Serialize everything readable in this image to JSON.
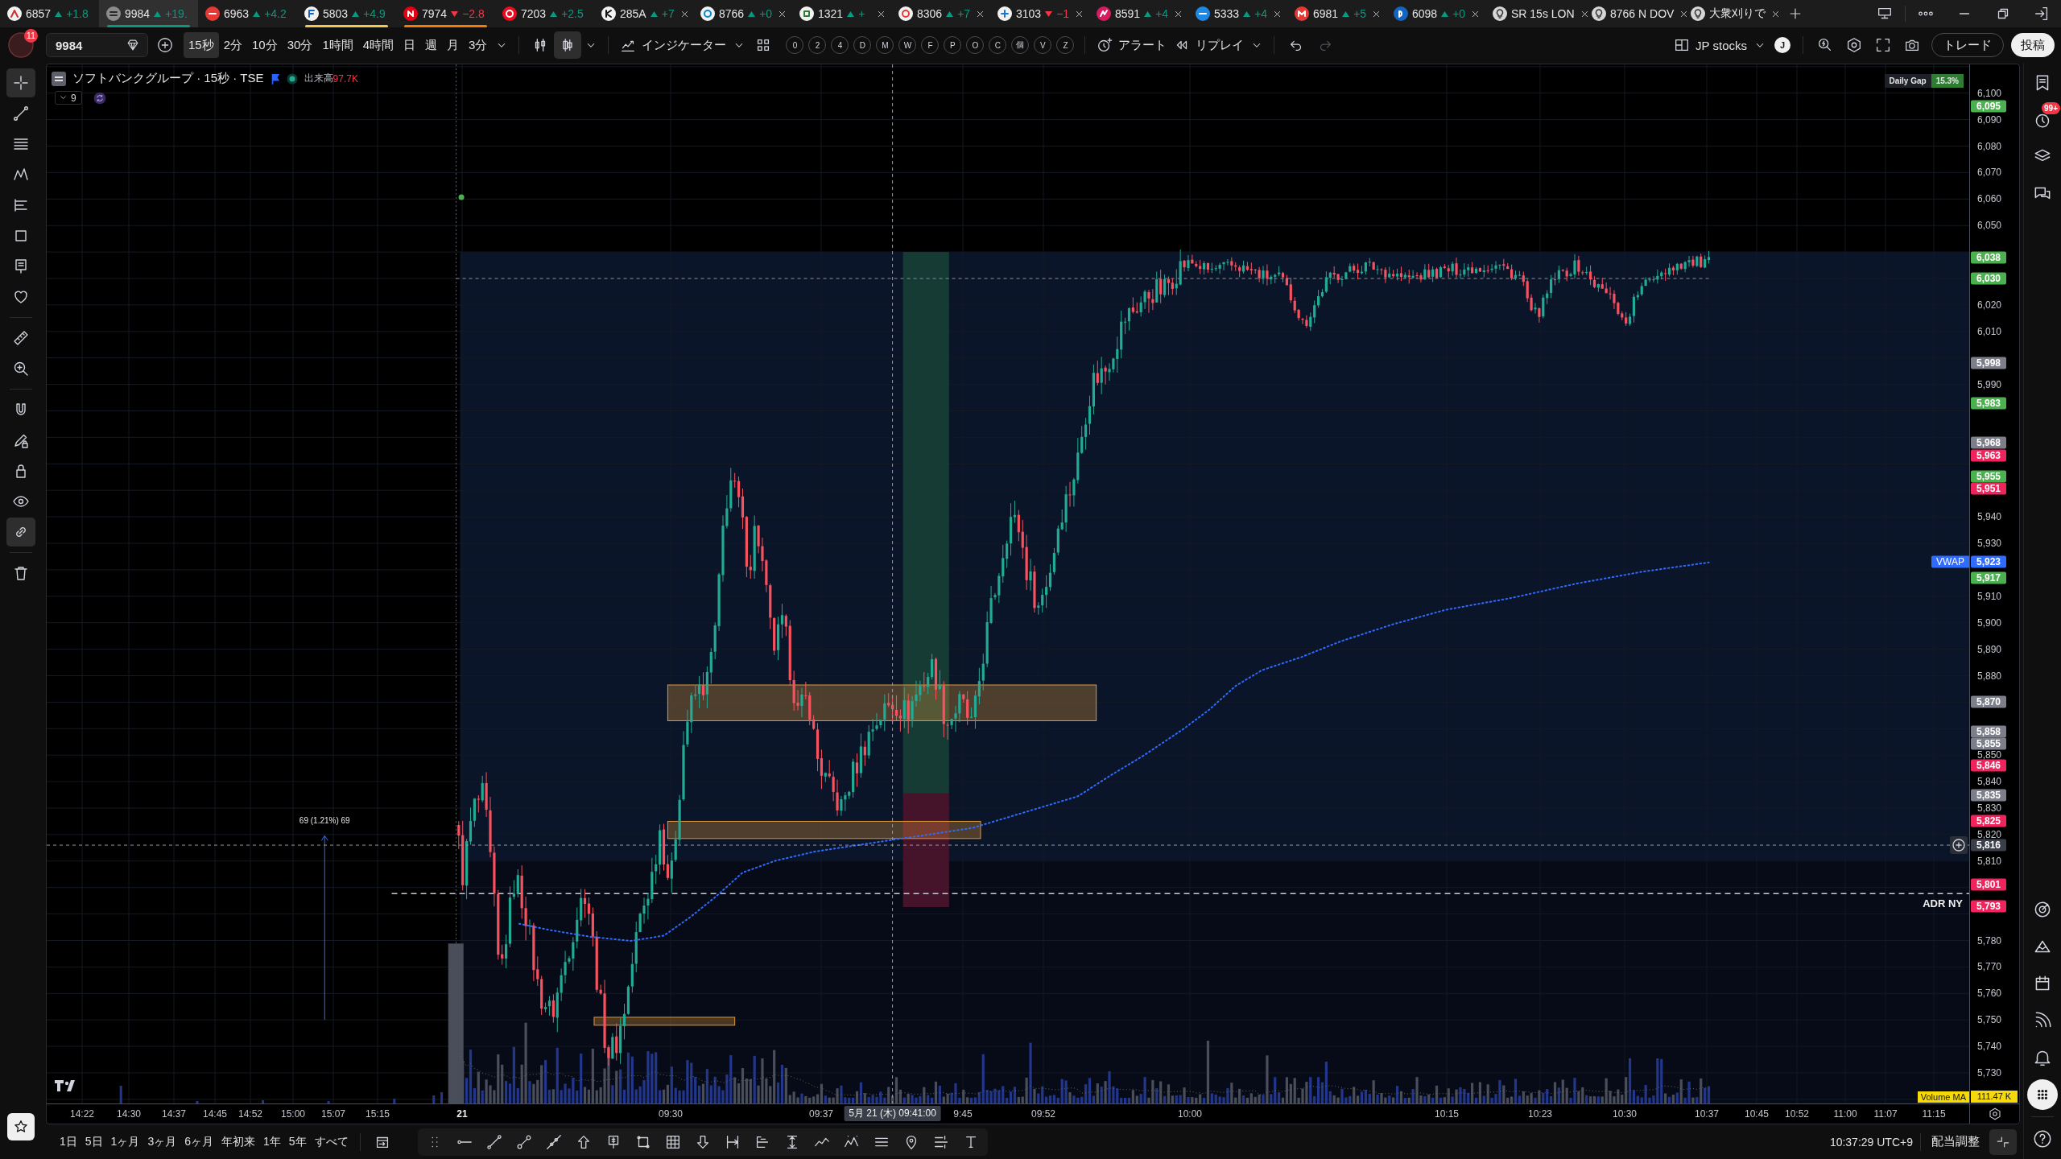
{
  "tabs": [
    {
      "kind": "symbol",
      "symbol": "6857",
      "up": true,
      "change": "+1.8",
      "closable": false,
      "selected": false
    },
    {
      "kind": "symbol",
      "symbol": "9984",
      "up": true,
      "change": "+19.",
      "closable": false,
      "selected": true,
      "color": "#089981"
    },
    {
      "kind": "symbol",
      "symbol": "6963",
      "up": true,
      "change": "+4.2",
      "closable": false,
      "selected": false
    },
    {
      "kind": "symbol",
      "symbol": "5803",
      "up": true,
      "change": "+4.9",
      "closable": false,
      "selected": false,
      "color": "#f2c94c"
    },
    {
      "kind": "symbol",
      "symbol": "7974",
      "up": false,
      "change": "−2.8",
      "closable": false,
      "selected": false,
      "color": "#f57c00"
    },
    {
      "kind": "symbol",
      "symbol": "7203",
      "up": true,
      "change": "+2.5",
      "closable": false,
      "selected": false
    },
    {
      "kind": "symbol",
      "symbol": "285A",
      "up": true,
      "change": "+7",
      "closable": true,
      "selected": false
    },
    {
      "kind": "symbol",
      "symbol": "8766",
      "up": true,
      "change": "+0",
      "closable": true,
      "selected": false
    },
    {
      "kind": "symbol",
      "symbol": "1321",
      "up": true,
      "change": "+",
      "closable": true,
      "selected": false
    },
    {
      "kind": "symbol",
      "symbol": "8306",
      "up": true,
      "change": "+7",
      "closable": true,
      "selected": false
    },
    {
      "kind": "symbol",
      "symbol": "3103",
      "up": false,
      "change": "−1",
      "closable": true,
      "selected": false
    },
    {
      "kind": "symbol",
      "symbol": "8591",
      "up": true,
      "change": "+4",
      "closable": true,
      "selected": false
    },
    {
      "kind": "symbol",
      "symbol": "5333",
      "up": true,
      "change": "+4",
      "closable": true,
      "selected": false
    },
    {
      "kind": "symbol",
      "symbol": "6981",
      "up": true,
      "change": "+5",
      "closable": true,
      "selected": false
    },
    {
      "kind": "symbol",
      "symbol": "6098",
      "up": true,
      "change": "+0",
      "closable": true,
      "selected": false
    },
    {
      "kind": "layout",
      "symbol": "SR 15s LON",
      "closable": true,
      "selected": false
    },
    {
      "kind": "layout",
      "symbol": "8766 N DOV",
      "closable": true,
      "selected": false
    },
    {
      "kind": "layout",
      "symbol": "大衆刈りで",
      "closable": true,
      "selected": false
    }
  ],
  "toolbar": {
    "notifications": "11",
    "symbol": "9984",
    "intervals": [
      {
        "label": "15秒",
        "selected": true
      },
      {
        "label": "2分",
        "selected": false
      },
      {
        "label": "10分",
        "selected": false
      },
      {
        "label": "30分",
        "selected": false
      },
      {
        "label": "1時間",
        "selected": false
      },
      {
        "label": "4時間",
        "selected": false
      },
      {
        "label": "日",
        "selected": false
      },
      {
        "label": "週",
        "selected": false
      },
      {
        "label": "月",
        "selected": false
      },
      {
        "label": "3分",
        "selected": false
      }
    ],
    "chart_styles": [
      {
        "selected": false
      },
      {
        "selected": true
      }
    ],
    "indicators": "インジケーター",
    "shortcuts": [
      "0",
      "2",
      "4",
      "D",
      "M",
      "W",
      "F",
      "P",
      "O",
      "C",
      "個",
      "V",
      "Z"
    ],
    "alert": "アラート",
    "replay": "リプレイ",
    "undo_disabled": false,
    "redo_disabled": true,
    "layout": "JP stocks",
    "user": "J",
    "trade": "トレード",
    "publish": "投稿"
  },
  "left_tools": [
    {
      "selected": true
    },
    {
      "selected": false
    },
    {
      "selected": false
    },
    {
      "selected": false
    },
    {
      "selected": false
    },
    {
      "selected": false
    },
    {
      "selected": false
    },
    {
      "selected": false
    },
    {
      "selected": false
    },
    {
      "selected": false
    },
    {
      "selected": false
    },
    {
      "selected": false
    },
    {
      "selected": false
    },
    {
      "selected": false
    },
    {
      "selected": true
    },
    {
      "selected": false
    }
  ],
  "favorites": {
    "selected": true
  },
  "chart": {
    "title": "ソフトバンクグループ · 15秒 · TSE",
    "volume_label": "出来高",
    "volume_value": "97.7K",
    "indicators_count": "9",
    "daily_gap": {
      "label": "Daily Gap",
      "value": "15.3%"
    },
    "price_ticks": [
      "6,100",
      "6,090",
      "6,080",
      "6,070",
      "6,060",
      "6,050",
      "6,020",
      "6,010",
      "5,990",
      "5,940",
      "5,930",
      "5,910",
      "5,900",
      "5,890",
      "5,880",
      "5,850",
      "5,840",
      "5,830",
      "5,820",
      "5,810",
      "5,780",
      "5,770",
      "5,760",
      "5,750",
      "5,740",
      "5,730"
    ],
    "price_labels": [
      {
        "text": "6,095",
        "color": "#4caf50"
      },
      {
        "text": "6,038",
        "color": "#4caf50"
      },
      {
        "text": "6,030",
        "color": "#4caf50"
      },
      {
        "text": "5,998",
        "color": "#7c7f8a"
      },
      {
        "text": "5,983",
        "color": "#4caf50"
      },
      {
        "text": "5,968",
        "color": "#7c7f8a"
      },
      {
        "text": "5,963",
        "color": "#f0245c"
      },
      {
        "text": "5,955",
        "color": "#4caf50"
      },
      {
        "text": "5,951",
        "color": "#f0245c"
      },
      {
        "text": "5,917",
        "color": "#4caf50"
      },
      {
        "text": "5,870",
        "color": "#7c7f8a"
      },
      {
        "text": "5,858",
        "color": "#7c7f8a"
      },
      {
        "text": "5,855",
        "color": "#7c7f8a"
      },
      {
        "text": "5,846",
        "color": "#f0245c"
      },
      {
        "text": "5,835",
        "color": "#7c7f8a"
      },
      {
        "text": "5,825",
        "color": "#f0245c"
      },
      {
        "text": "5,801",
        "color": "#f0245c"
      },
      {
        "text": "5,793",
        "color": "#f0245c"
      }
    ],
    "vwap": {
      "label": "VWAP",
      "value": "5,923"
    },
    "crosshair": {
      "price": "5,816",
      "time": "5月 21 (木) 09:41:00"
    },
    "adr_label": "ADR NY",
    "measure_label": "69 (1.21%) 69",
    "time_ticks": [
      {
        "text": "14:22",
        "kind": "time"
      },
      {
        "text": "14:30",
        "kind": "time"
      },
      {
        "text": "14:37",
        "kind": "time"
      },
      {
        "text": "14:45",
        "kind": "time"
      },
      {
        "text": "14:52",
        "kind": "time"
      },
      {
        "text": "15:00",
        "kind": "time"
      },
      {
        "text": "15:07",
        "kind": "time"
      },
      {
        "text": "15:15",
        "kind": "time"
      },
      {
        "text": "21",
        "kind": "day"
      },
      {
        "text": "09:30",
        "kind": "time"
      },
      {
        "text": "09:37",
        "kind": "time"
      },
      {
        "text": "9:45",
        "kind": "time"
      },
      {
        "text": "09:52",
        "kind": "time"
      },
      {
        "text": "10:00",
        "kind": "time"
      },
      {
        "text": "10:15",
        "kind": "time"
      },
      {
        "text": "10:23",
        "kind": "time"
      },
      {
        "text": "10:30",
        "kind": "time"
      },
      {
        "text": "10:37",
        "kind": "time"
      },
      {
        "text": "10:45",
        "kind": "time"
      },
      {
        "text": "10:52",
        "kind": "time"
      },
      {
        "text": "11:00",
        "kind": "time"
      },
      {
        "text": "11:07",
        "kind": "time"
      },
      {
        "text": "11:15",
        "kind": "time"
      }
    ],
    "volume_ma": {
      "label": "Volume MA",
      "value": "111.47 K"
    }
  },
  "bottom_bar": {
    "ranges": [
      "1日",
      "5日",
      "1ヶ月",
      "3ヶ月",
      "6ヶ月",
      "年初来",
      "1年",
      "5年",
      "すべて"
    ],
    "clock": "10:37:29 UTC+9",
    "adjust": "配当調整"
  },
  "right_panel": {
    "alerts_badge": "99+",
    "items": [
      {
        "selected": false
      },
      {
        "selected": false
      },
      {
        "selected": false
      },
      {
        "selected": false
      },
      {
        "selected": false
      },
      {
        "selected": false
      },
      {
        "selected": false
      },
      {
        "selected": false
      },
      {
        "selected": false
      },
      {
        "selected": true
      },
      {
        "selected": false
      }
    ]
  }
}
